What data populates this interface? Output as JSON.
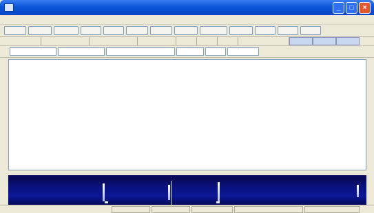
{
  "window": {
    "title": "",
    "buttons": {
      "minimize": "_",
      "maximize": "□",
      "close": "×"
    }
  },
  "menubar": {
    "items": [
      "",
      "",
      "",
      "",
      "",
      "",
      "",
      "",
      "",
      ""
    ]
  },
  "toolbar": {
    "buttons": [
      "",
      "",
      "",
      "",
      "",
      "",
      "",
      "",
      "",
      "",
      "",
      "",
      ""
    ]
  },
  "fields": {
    "headers": [
      "",
      "",
      "",
      "",
      "",
      "",
      "",
      "",
      "",
      "",
      ""
    ],
    "values": [
      "",
      "",
      "",
      "",
      "",
      ""
    ]
  },
  "console": {
    "lines": [
      "",
      "",
      "",
      "",
      "",
      "",
      "",
      "",
      "",
      "",
      "",
      "",
      "",
      "",
      ""
    ]
  },
  "waterfall": {
    "ticks": [
      "",
      "",
      "",
      ""
    ]
  },
  "statusbar": {
    "cells": [
      "",
      "",
      "",
      "",
      "",
      ""
    ]
  }
}
